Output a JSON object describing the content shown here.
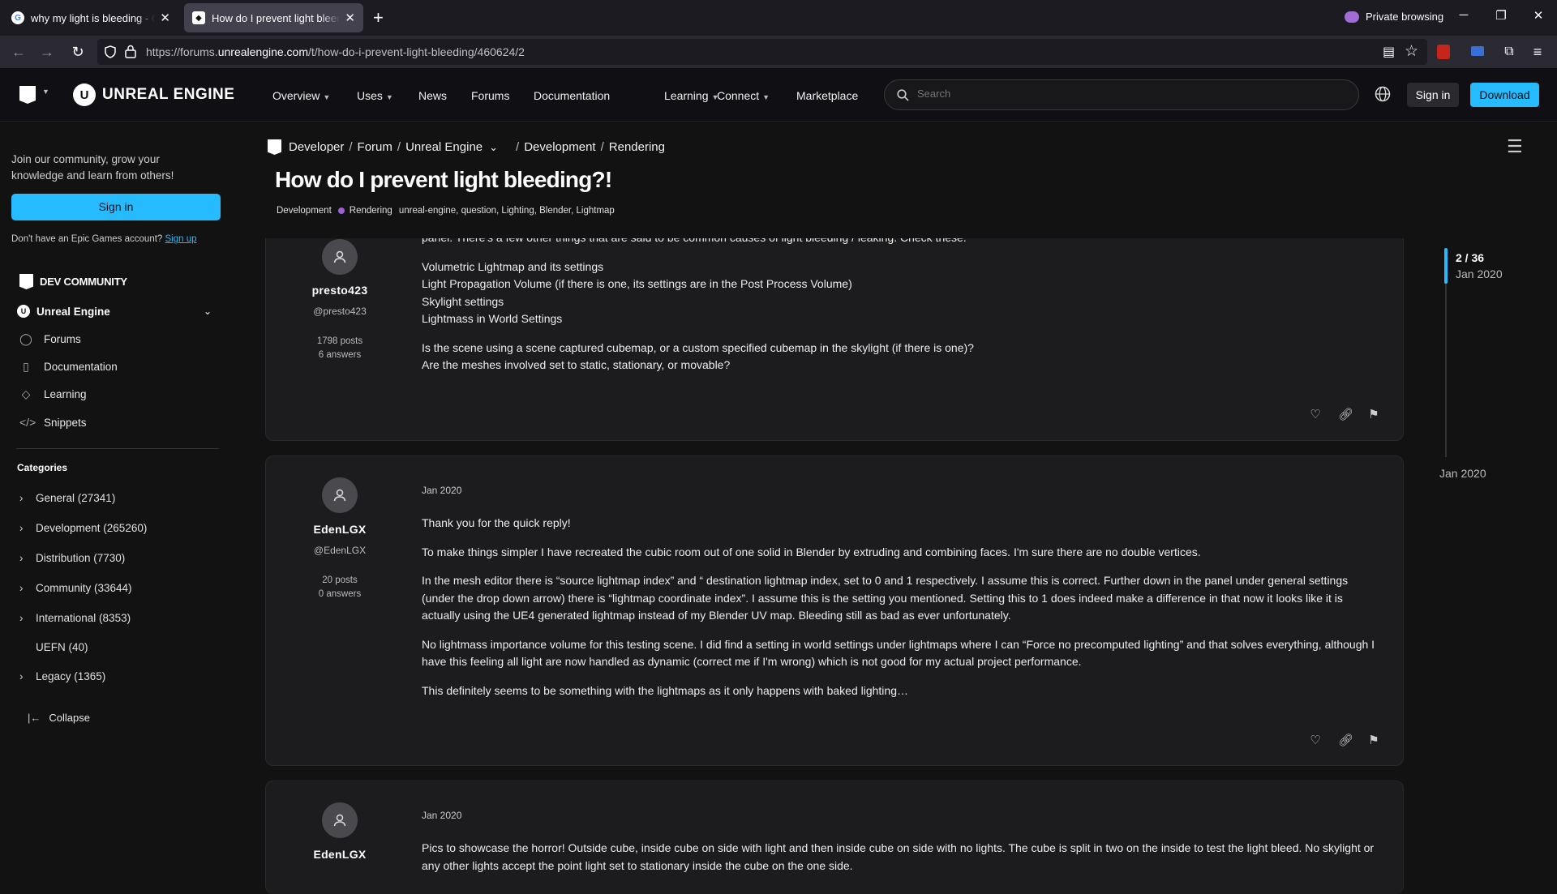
{
  "browser": {
    "tabs": [
      {
        "title": "why my light is bleeding - Google Search",
        "active": false
      },
      {
        "title": "How do I prevent light bleeding?! - Rendering - Epic Developer Community Forums",
        "active": true
      }
    ],
    "private_label": "Private browsing",
    "url_prefix": "https://forums.",
    "url_domain": "unrealengine.com",
    "url_path": "/t/how-do-i-prevent-light-bleeding/460624/2"
  },
  "header": {
    "logo_text": "UNREAL ENGINE",
    "nav": [
      "Overview",
      "Uses",
      "News",
      "Forums",
      "Documentation",
      "Learning",
      "Connect",
      "Marketplace"
    ],
    "search_placeholder": "Search",
    "signin": "Sign in",
    "download": "Download"
  },
  "sidebar": {
    "join_text": "Join our community, grow your knowledge and learn from others!",
    "signin": "Sign in",
    "no_account": "Don't have an Epic Games account?",
    "signup": "Sign up",
    "dev_community": "DEV COMMUNITY",
    "product": "Unreal Engine",
    "links": [
      "Forums",
      "Documentation",
      "Learning",
      "Snippets"
    ],
    "categories_title": "Categories",
    "categories": [
      {
        "label": "General (27341)",
        "expandable": true
      },
      {
        "label": "Development (265260)",
        "expandable": true
      },
      {
        "label": "Distribution (7730)",
        "expandable": true
      },
      {
        "label": "Community (33644)",
        "expandable": true
      },
      {
        "label": "International (8353)",
        "expandable": true
      },
      {
        "label": "UEFN (40)",
        "expandable": false
      },
      {
        "label": "Legacy (1365)",
        "expandable": true
      }
    ],
    "collapse": "Collapse"
  },
  "topic": {
    "breadcrumb": [
      "Developer",
      "Forum",
      "Unreal Engine",
      "Development",
      "Rendering"
    ],
    "title": "How do I prevent light bleeding?!",
    "category": "Development",
    "subcategory": "Rendering",
    "tags": "unreal-engine, question, Lighting, Blender, Lightmap"
  },
  "posts": [
    {
      "user": "presto423",
      "handle": "@presto423",
      "posts": "1798 posts",
      "answers": "6 answers",
      "cut_line": "panel. There's a few other things that are said to be common causes of light bleeding / leaking. Check these.",
      "list": [
        "Volumetric Lightmap and its settings",
        "Light Propagation Volume (if there is one, its settings are in the Post Process Volume)",
        "Skylight settings",
        "Lightmass in World Settings"
      ],
      "question1": "Is the scene using a scene captured cubemap, or a custom specified cubemap in the skylight (if there is one)?",
      "question2": "Are the meshes involved set to static, stationary, or movable?"
    },
    {
      "user": "EdenLGX",
      "handle": "@EdenLGX",
      "posts": "20 posts",
      "answers": "0 answers",
      "date": "Jan 2020",
      "paragraphs": [
        "Thank you for the quick reply!",
        "To make things simpler I have recreated the cubic room out of one solid in Blender by extruding and combining faces. I'm sure there are no double vertices.",
        "In the mesh editor there is “source lightmap index” and “ destination lightmap index, set to 0 and 1 respectively. I assume this is correct. Further down in the panel under general settings (under the drop down arrow) there is “lightmap coordinate index”. I assume this is the setting you mentioned. Setting this to 1 does indeed make a difference in that now it looks like it is actually using the UE4 generated lightmap instead of my Blender UV map. Bleeding still as bad as ever unfortunately.",
        "No lightmass importance volume for this testing scene. I did find a setting in world settings under lightmaps where I can “Force no precomputed lighting” and that solves everything, although I have this feeling all light are now handled as dynamic (correct me if I'm wrong) which is not good for my actual project performance.",
        "This definitely seems to be something with the lightmaps as it only happens with baked lighting…"
      ]
    },
    {
      "user": "EdenLGX",
      "date": "Jan 2020",
      "text": "Pics to showcase the horror! Outside cube, inside cube on side with light and then inside cube on side with no lights. The cube is split in two on the inside to test the light bleed. No skylight or any other lights accept the point light set to stationary inside the cube on the one side."
    }
  ],
  "timeline": {
    "position": "2 / 36",
    "date_top": "Jan 2020",
    "date_bottom": "Jan 2020",
    "progress_fraction": 0.056
  },
  "colors": {
    "accent": "#26bbff",
    "page_bg": "#121212",
    "post_bg": "#1c1c1f",
    "rendering_dot": "#9f5fd6"
  }
}
